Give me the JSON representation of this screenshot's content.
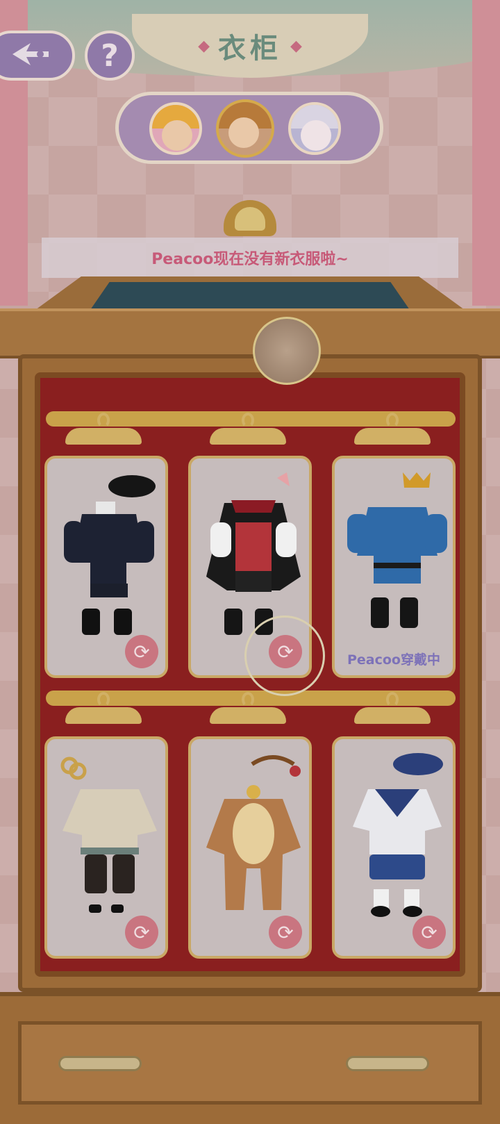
{
  "header": {
    "title": "衣柜",
    "back_icon": "back-arrow-icon",
    "help_label": "?"
  },
  "characters": [
    {
      "name": "character-1",
      "selected": false,
      "hair_color": "#e5a93e"
    },
    {
      "name": "character-2",
      "selected": true,
      "hair_color": "#b77a3a"
    },
    {
      "name": "character-3",
      "selected": false,
      "hair_color": "#d9d4e2"
    }
  ],
  "notice": {
    "text": "Peacoo现在没有新衣服啦~"
  },
  "outfits": [
    {
      "id": "outfit-black-uniform",
      "wearing": false,
      "swap_icon": "swap-icon"
    },
    {
      "id": "outfit-vampire",
      "wearing": false,
      "swap_icon": "swap-icon"
    },
    {
      "id": "outfit-blue-prince",
      "wearing": true,
      "wearing_label": "Peacoo穿戴中"
    },
    {
      "id": "outfit-chinese-style",
      "wearing": false,
      "swap_icon": "swap-icon"
    },
    {
      "id": "outfit-reindeer",
      "wearing": false,
      "swap_icon": "swap-icon"
    },
    {
      "id": "outfit-sailor",
      "wearing": false,
      "swap_icon": "swap-icon"
    }
  ],
  "colors": {
    "accent_purple": "#8f79a8",
    "notice_pink": "#c75a78",
    "wood": "#9c6b38",
    "velvet": "#8a1f1f"
  }
}
